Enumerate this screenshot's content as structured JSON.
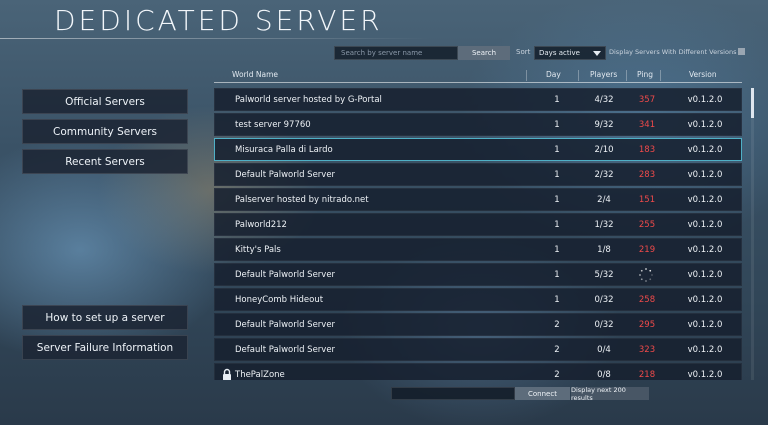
{
  "page": {
    "title": "DEDICATED SERVER"
  },
  "search": {
    "placeholder": "Search by server name",
    "button_label": "Search"
  },
  "sort": {
    "label": "Sort",
    "selected": "Days active"
  },
  "versions_filter": {
    "label": "Display Servers With Different Versions",
    "checked": false
  },
  "nav": {
    "official": "Official Servers",
    "community": "Community Servers",
    "recent": "Recent Servers",
    "setup": "How to set up a server",
    "failure": "Server Failure Information"
  },
  "table": {
    "headers": {
      "world": "World Name",
      "day": "Day",
      "players": "Players",
      "ping": "Ping",
      "version": "Version"
    },
    "rows": [
      {
        "name": "Palworld server hosted by G-Portal",
        "day": "1",
        "players": "4/32",
        "ping": "357",
        "version": "v0.1.2.0",
        "locked": false,
        "selected": false
      },
      {
        "name": "test server 97760",
        "day": "1",
        "players": "9/32",
        "ping": "341",
        "version": "v0.1.2.0",
        "locked": false,
        "selected": false
      },
      {
        "name": "Misuraca Palla di Lardo",
        "day": "1",
        "players": "2/10",
        "ping": "183",
        "version": "v0.1.2.0",
        "locked": false,
        "selected": true
      },
      {
        "name": "Default Palworld Server",
        "day": "1",
        "players": "2/32",
        "ping": "283",
        "version": "v0.1.2.0",
        "locked": false,
        "selected": false
      },
      {
        "name": "Palserver hosted by nitrado.net",
        "day": "1",
        "players": "2/4",
        "ping": "151",
        "version": "v0.1.2.0",
        "locked": false,
        "selected": false
      },
      {
        "name": "Palworld212",
        "day": "1",
        "players": "1/32",
        "ping": "255",
        "version": "v0.1.2.0",
        "locked": false,
        "selected": false
      },
      {
        "name": "Kitty's Pals",
        "day": "1",
        "players": "1/8",
        "ping": "219",
        "version": "v0.1.2.0",
        "locked": false,
        "selected": false
      },
      {
        "name": "Default Palworld Server",
        "day": "1",
        "players": "5/32",
        "ping": "",
        "version": "v0.1.2.0",
        "locked": false,
        "selected": false,
        "loading": true
      },
      {
        "name": "HoneyComb Hideout",
        "day": "1",
        "players": "0/32",
        "ping": "258",
        "version": "v0.1.2.0",
        "locked": false,
        "selected": false
      },
      {
        "name": "Default Palworld Server",
        "day": "2",
        "players": "0/32",
        "ping": "295",
        "version": "v0.1.2.0",
        "locked": false,
        "selected": false
      },
      {
        "name": "Default Palworld Server",
        "day": "2",
        "players": "0/4",
        "ping": "323",
        "version": "v0.1.2.0",
        "locked": false,
        "selected": false
      },
      {
        "name": "ThePalZone",
        "day": "2",
        "players": "0/8",
        "ping": "218",
        "version": "v0.1.2.0",
        "locked": true,
        "selected": false
      }
    ]
  },
  "bottom": {
    "connect_label": "Connect",
    "next_label": "Display next 200 results"
  },
  "colors": {
    "ping": "#f04a4a",
    "selected_border": "#4fb0c6"
  }
}
